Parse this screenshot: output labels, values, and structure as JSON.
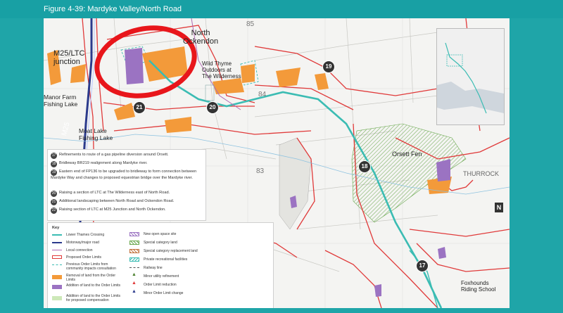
{
  "header": {
    "title": "Figure 4-39: Mardyke Valley/North Road"
  },
  "colors": {
    "frame": "#1fa5a8",
    "order_limits": "#e03a3a",
    "lower_thames_crossing": "#3bbcb3",
    "motorway": "#2b3a8c",
    "local_connection": "#b06ab3",
    "removal": "#f39a3a",
    "addition": "#9b73c2",
    "special_category": "#6aa84f",
    "highlight_circle": "#e8161b"
  },
  "map_labels": {
    "north_ockendon": "North\nOckendon",
    "m25_junction": "M25/LTC\njunction",
    "manor_farm": "Manor Farm\nFishing Lake",
    "moat_lake": "Moat Lake\nFishing Lake",
    "wild_thyme": "Wild Thyme\nOutdoors at\nThe Wilderness",
    "orsett_fen": "Orsett Fen",
    "thurrock": "THURROCK",
    "m25_road": "M25",
    "foxhounds": "Foxhounds\nRiding School",
    "grid_85": "85",
    "grid_84": "84",
    "grid_83": "83"
  },
  "markers": [
    "17",
    "18",
    "19",
    "20",
    "21",
    "22"
  ],
  "notes": [
    {
      "num": "17",
      "text": "Refinements to route of a gas pipeline diversion around Orsett."
    },
    {
      "num": "18",
      "text": "Bridleway BR219 realignment along Mardyke river."
    },
    {
      "num": "19",
      "text": "Eastern end of FP136 to be upgraded to bridleway to form connection between Mardyke Way and changes to proposed equestrian bridge over the Mardyke river."
    },
    {
      "num": "20",
      "text": "Raising a section of LTC at The Wilderness east of North Road."
    },
    {
      "num": "21",
      "text": "Additional landscaping between North Road and Ockendon Road."
    },
    {
      "num": "22",
      "text": "Raising section of LTC at M25 Junction and North Ockendon."
    }
  ],
  "legend": {
    "title": "Key",
    "left": [
      "Lower Thames Crossing",
      "Motorway/major road",
      "Local connection",
      "Proposed Order Limits",
      "Previous Order Limits from community impacts consultation",
      "Removal of land from the Order Limits",
      "Addition of land to the Order Limits",
      "Addition of land to the Order Limits for proposed compensation"
    ],
    "right": [
      "New open space site",
      "Special category land",
      "Special category replacement land",
      "Private recreational facilities",
      "Railway line",
      "Minor utility refinement",
      "Order Limit reduction",
      "Minor Order Limit change"
    ]
  },
  "north_arrow": "N"
}
